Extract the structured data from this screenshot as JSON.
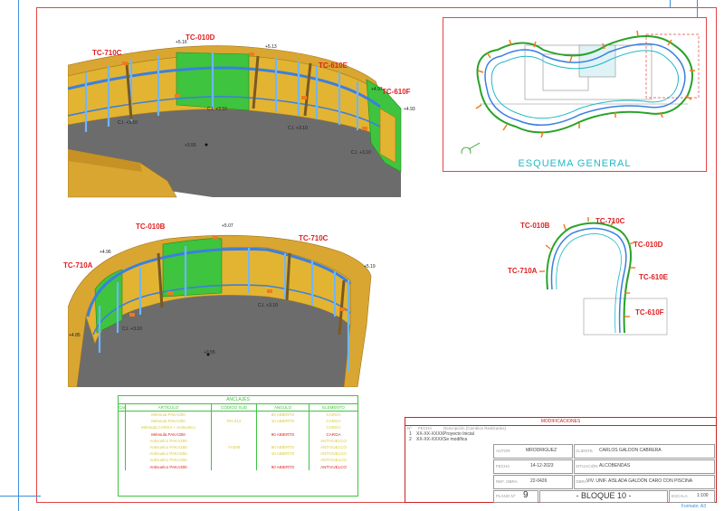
{
  "views": {
    "top": {
      "labels": [
        "TC-710C",
        "TC-010D",
        "TC-610E",
        "TC-610F"
      ],
      "levels": [
        "+5.16",
        "+5.13",
        "+4.97",
        "+4.93",
        "C.I. +3.10",
        "C.I. +3.10",
        "C.I. +3.10",
        "C.I. +3.10",
        "+3.55"
      ]
    },
    "bottom": {
      "labels": [
        "TC-010B",
        "TC-710C",
        "TC-710A"
      ],
      "levels": [
        "+4.96",
        "+5.07",
        "+5.19",
        "+4.85",
        "C.I. +3.10",
        "C.I. +3.10",
        "+3.55"
      ]
    }
  },
  "scheme": {
    "title": "ESQUEMA GENERAL"
  },
  "plan": {
    "labels": [
      "TC-010B",
      "TC-710C",
      "TC-010D",
      "TC-710A",
      "TC-610E",
      "TC-610F"
    ]
  },
  "anclajes": {
    "caption": "ANCLAJES",
    "headers": [
      "Cant.",
      "ARTÍCULO",
      "CÓDIGO SUD",
      "ÁNGULO",
      "ELEMENTO"
    ],
    "rows": [
      [
        "",
        "Ménsula PAKA250",
        "",
        "90 ABIERTO",
        "CARGA"
      ],
      [
        "",
        "Ménsula PAKA250",
        "RH-214",
        "10 ABIERTO",
        "CARGA"
      ],
      [
        "",
        "Ménsula CARGA + Antivuelco",
        "",
        "",
        "CARGA"
      ],
      [
        "",
        "Ménsula PAKA300",
        "",
        "90 ABIERTO",
        "CARGA"
      ],
      [
        "",
        "Antivuelco PAKA250",
        "",
        "",
        "ANTIVUELCO"
      ],
      [
        "",
        "Antivuelco PAKA250",
        "YH208",
        "90 ABIERTO",
        "ANTIVUELCO"
      ],
      [
        "",
        "Antivuelco PAKA250",
        "",
        "10 ABIERTO",
        "ANTIVUELCO"
      ],
      [
        "",
        "Antivuelco PAKA250",
        "",
        "",
        "ANTIVUELCO"
      ],
      [
        "",
        "Antivuelco PAKA300",
        "",
        "90 ABIERTO",
        "ANTIVUELCO"
      ]
    ]
  },
  "titleblock": {
    "mod_caption": "MODIFICACIONES",
    "mod_headers": [
      "Nº",
      "FECHA",
      "Descripción (Cambios Realizados)"
    ],
    "mods": [
      [
        "1",
        "XX-XX-XXXX",
        "Proyecto Inicial"
      ],
      [
        "2",
        "XX-XX-XXXX",
        "Se modifica"
      ]
    ],
    "autor_k": "AUTOR",
    "autor": "MRODRIGUEZ",
    "fecha_k": "FECHA",
    "fecha": "14-12-2023",
    "ref_k": "REF. OBRA",
    "ref": "22-0426",
    "cliente_k": "CLIENTE",
    "cliente": "CARLOS GALDON CABRERA",
    "situacion_k": "SITUACIÓN",
    "situacion": "ALCOBENDAS",
    "obra_k": "OBRA",
    "obra": "VIV. UNIF. AISLADA GALDÓN CARO CON PISCINA",
    "plano_k": "PLANO Nº",
    "plano": "9",
    "bloque": "- BLOQUE 10 -",
    "escala_k": "ESCALA",
    "escala": "1:100"
  },
  "format": "Formato: A3"
}
